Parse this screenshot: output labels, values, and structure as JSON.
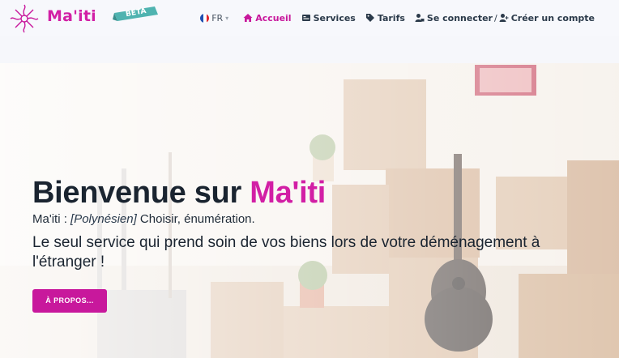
{
  "brand": {
    "name": "Ma'iti",
    "badge": "BETA"
  },
  "nav": {
    "language": "FR",
    "items": [
      {
        "label": "Accueil",
        "icon": "home-icon",
        "active": true
      },
      {
        "label": "Services",
        "icon": "services-icon",
        "active": false
      },
      {
        "label": "Tarifs",
        "icon": "tag-icon",
        "active": false
      }
    ],
    "login": {
      "label": "Se connecter",
      "icon": "user-lock-icon"
    },
    "separator": "/",
    "register": {
      "label": "Créer un compte",
      "icon": "user-plus-icon"
    }
  },
  "hero": {
    "title_prefix": "Bienvenue sur ",
    "title_brand": "Ma'iti",
    "definition_prefix": "Ma'iti : ",
    "definition_origin": "[Polynésien]",
    "definition_text": " Choisir, énumération.",
    "description": "Le seul service qui prend soin de vos biens lors de votre déménagement à l'étranger !",
    "cta_label": "À PROPOS..."
  },
  "colors": {
    "accent": "#c8189c",
    "brand": "#d21fa5",
    "text": "#1a2430",
    "nav_bg": "#f7f8fc"
  }
}
